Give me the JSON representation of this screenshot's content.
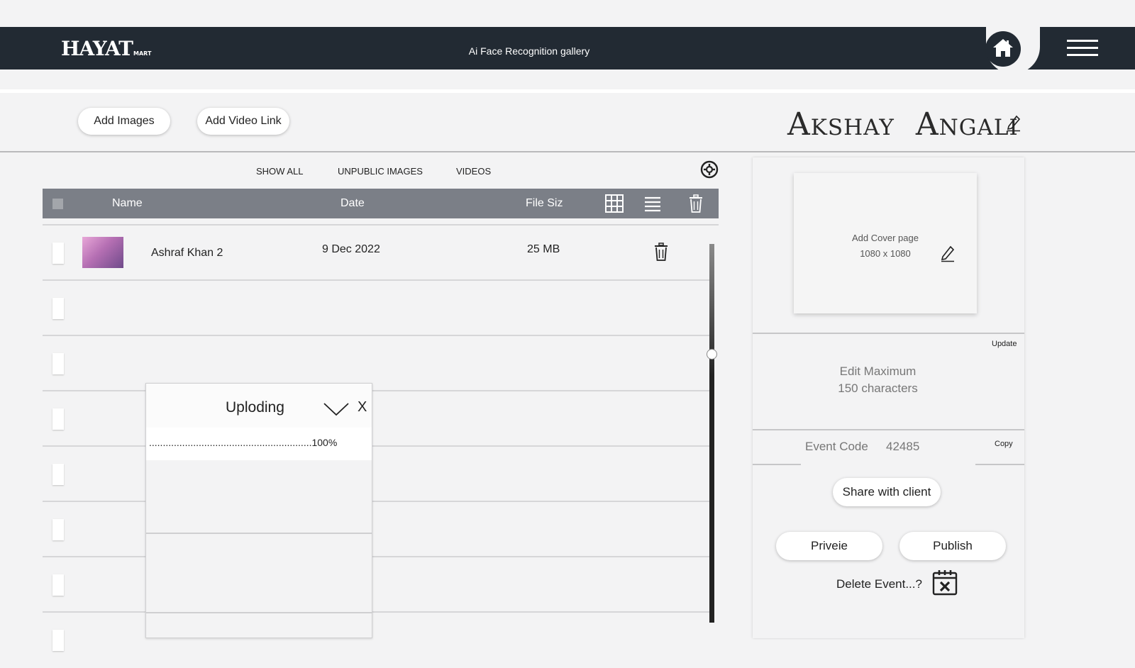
{
  "header": {
    "logo_text": "HAYAT",
    "logo_sub": "MART",
    "title": "Ai Face Recognition gallery",
    "home_icon": "home-icon",
    "menu_icon": "hamburger-menu-icon"
  },
  "actions": {
    "add_images": "Add Images",
    "add_video_link": "Add Video Link"
  },
  "event": {
    "name_first": "Akshay",
    "name_second": "Angali"
  },
  "filters": {
    "tabs": [
      "SHOW ALL",
      "UNPUBLIC IMAGES",
      "VIDEOS"
    ]
  },
  "table": {
    "columns": {
      "name": "Name",
      "date": "Date",
      "file_size": "File Siz"
    },
    "rows": [
      {
        "name": "Ashraf Khan 2",
        "date": "9 Dec 2022",
        "size": "25 MB"
      }
    ]
  },
  "upload": {
    "title": "Uploding",
    "close": "X",
    "progress_text": "...........................................................100%",
    "progress": 1.0
  },
  "sidebar": {
    "cover_title": "Add Cover page",
    "cover_size": "1080 x 1080",
    "update": "Update",
    "desc_line1": "Edit Maximum",
    "desc_line2": "150 characters",
    "event_code_label": "Event Code",
    "event_code_value": "42485",
    "copy": "Copy",
    "share": "Share with client",
    "preview": "Priveie",
    "publish": "Publish",
    "delete": "Delete Event...?"
  },
  "colors": {
    "topbar": "#222a33",
    "table_header": "#7b7f87",
    "background": "#f3f3f4"
  }
}
